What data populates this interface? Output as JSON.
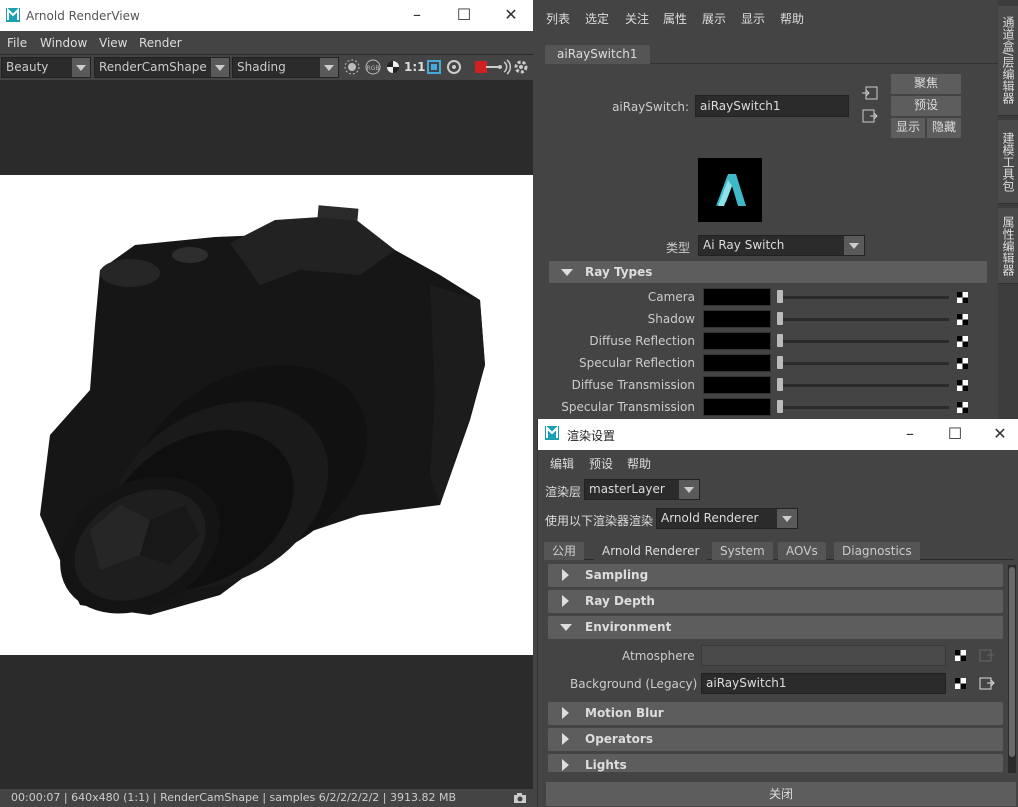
{
  "renderview": {
    "title": "Arnold RenderView",
    "menu": [
      "File",
      "Window",
      "View",
      "Render"
    ],
    "toolbar": {
      "aov": "Beauty",
      "camera": "RenderCamShape",
      "shading": "Shading",
      "ratio": "1:1",
      "icons": [
        "exposure-icon",
        "rgb-channel-icon",
        "pie-chart-icon",
        "crop-region-icon",
        "refresh-icon",
        "stop-render-icon",
        "ipr-icon",
        "settings-gear-icon"
      ]
    },
    "status": "00:00:07 | 640x480 (1:1) | RenderCamShape  | samples 6/2/2/2/2/2 | 3913.82 MB"
  },
  "attribute_editor": {
    "menu": [
      "列表",
      "选定",
      "关注",
      "属性",
      "展示",
      "显示",
      "帮助"
    ],
    "tab": "aiRaySwitch1",
    "node_label": "aiRaySwitch:",
    "node_value": "aiRaySwitch1",
    "buttons": {
      "focus": "聚焦",
      "presets": "预设",
      "show": "显示",
      "hide": "隐藏"
    },
    "type_label": "类型",
    "type_value": "Ai Ray Switch",
    "section_title": "Ray Types",
    "ray_types": [
      "Camera",
      "Shadow",
      "Diffuse Reflection",
      "Specular Reflection",
      "Diffuse Transmission",
      "Specular Transmission"
    ]
  },
  "side_tabs": [
    "通道盒/层编辑器",
    "建模工具包",
    "属性编辑器"
  ],
  "render_settings": {
    "title": "渲染设置",
    "menu": [
      "编辑",
      "预设",
      "帮助"
    ],
    "layer_label": "渲染层",
    "layer_value": "masterLayer",
    "renderer_label": "使用以下渲染器渲染",
    "renderer_value": "Arnold Renderer",
    "tabs": [
      "公用",
      "Arnold Renderer",
      "System",
      "AOVs",
      "Diagnostics"
    ],
    "sections": {
      "sampling": "Sampling",
      "ray_depth": "Ray Depth",
      "environment": "Environment",
      "motion_blur": "Motion Blur",
      "operators": "Operators",
      "lights": "Lights"
    },
    "atmosphere_label": "Atmosphere",
    "background_label": "Background (Legacy)",
    "background_value": "aiRaySwitch1",
    "close_label": "关闭"
  },
  "colors": {
    "panel": "#444444",
    "field": "#2b2b2b",
    "section": "#5d5d5d",
    "accent_red": "#d02020"
  }
}
